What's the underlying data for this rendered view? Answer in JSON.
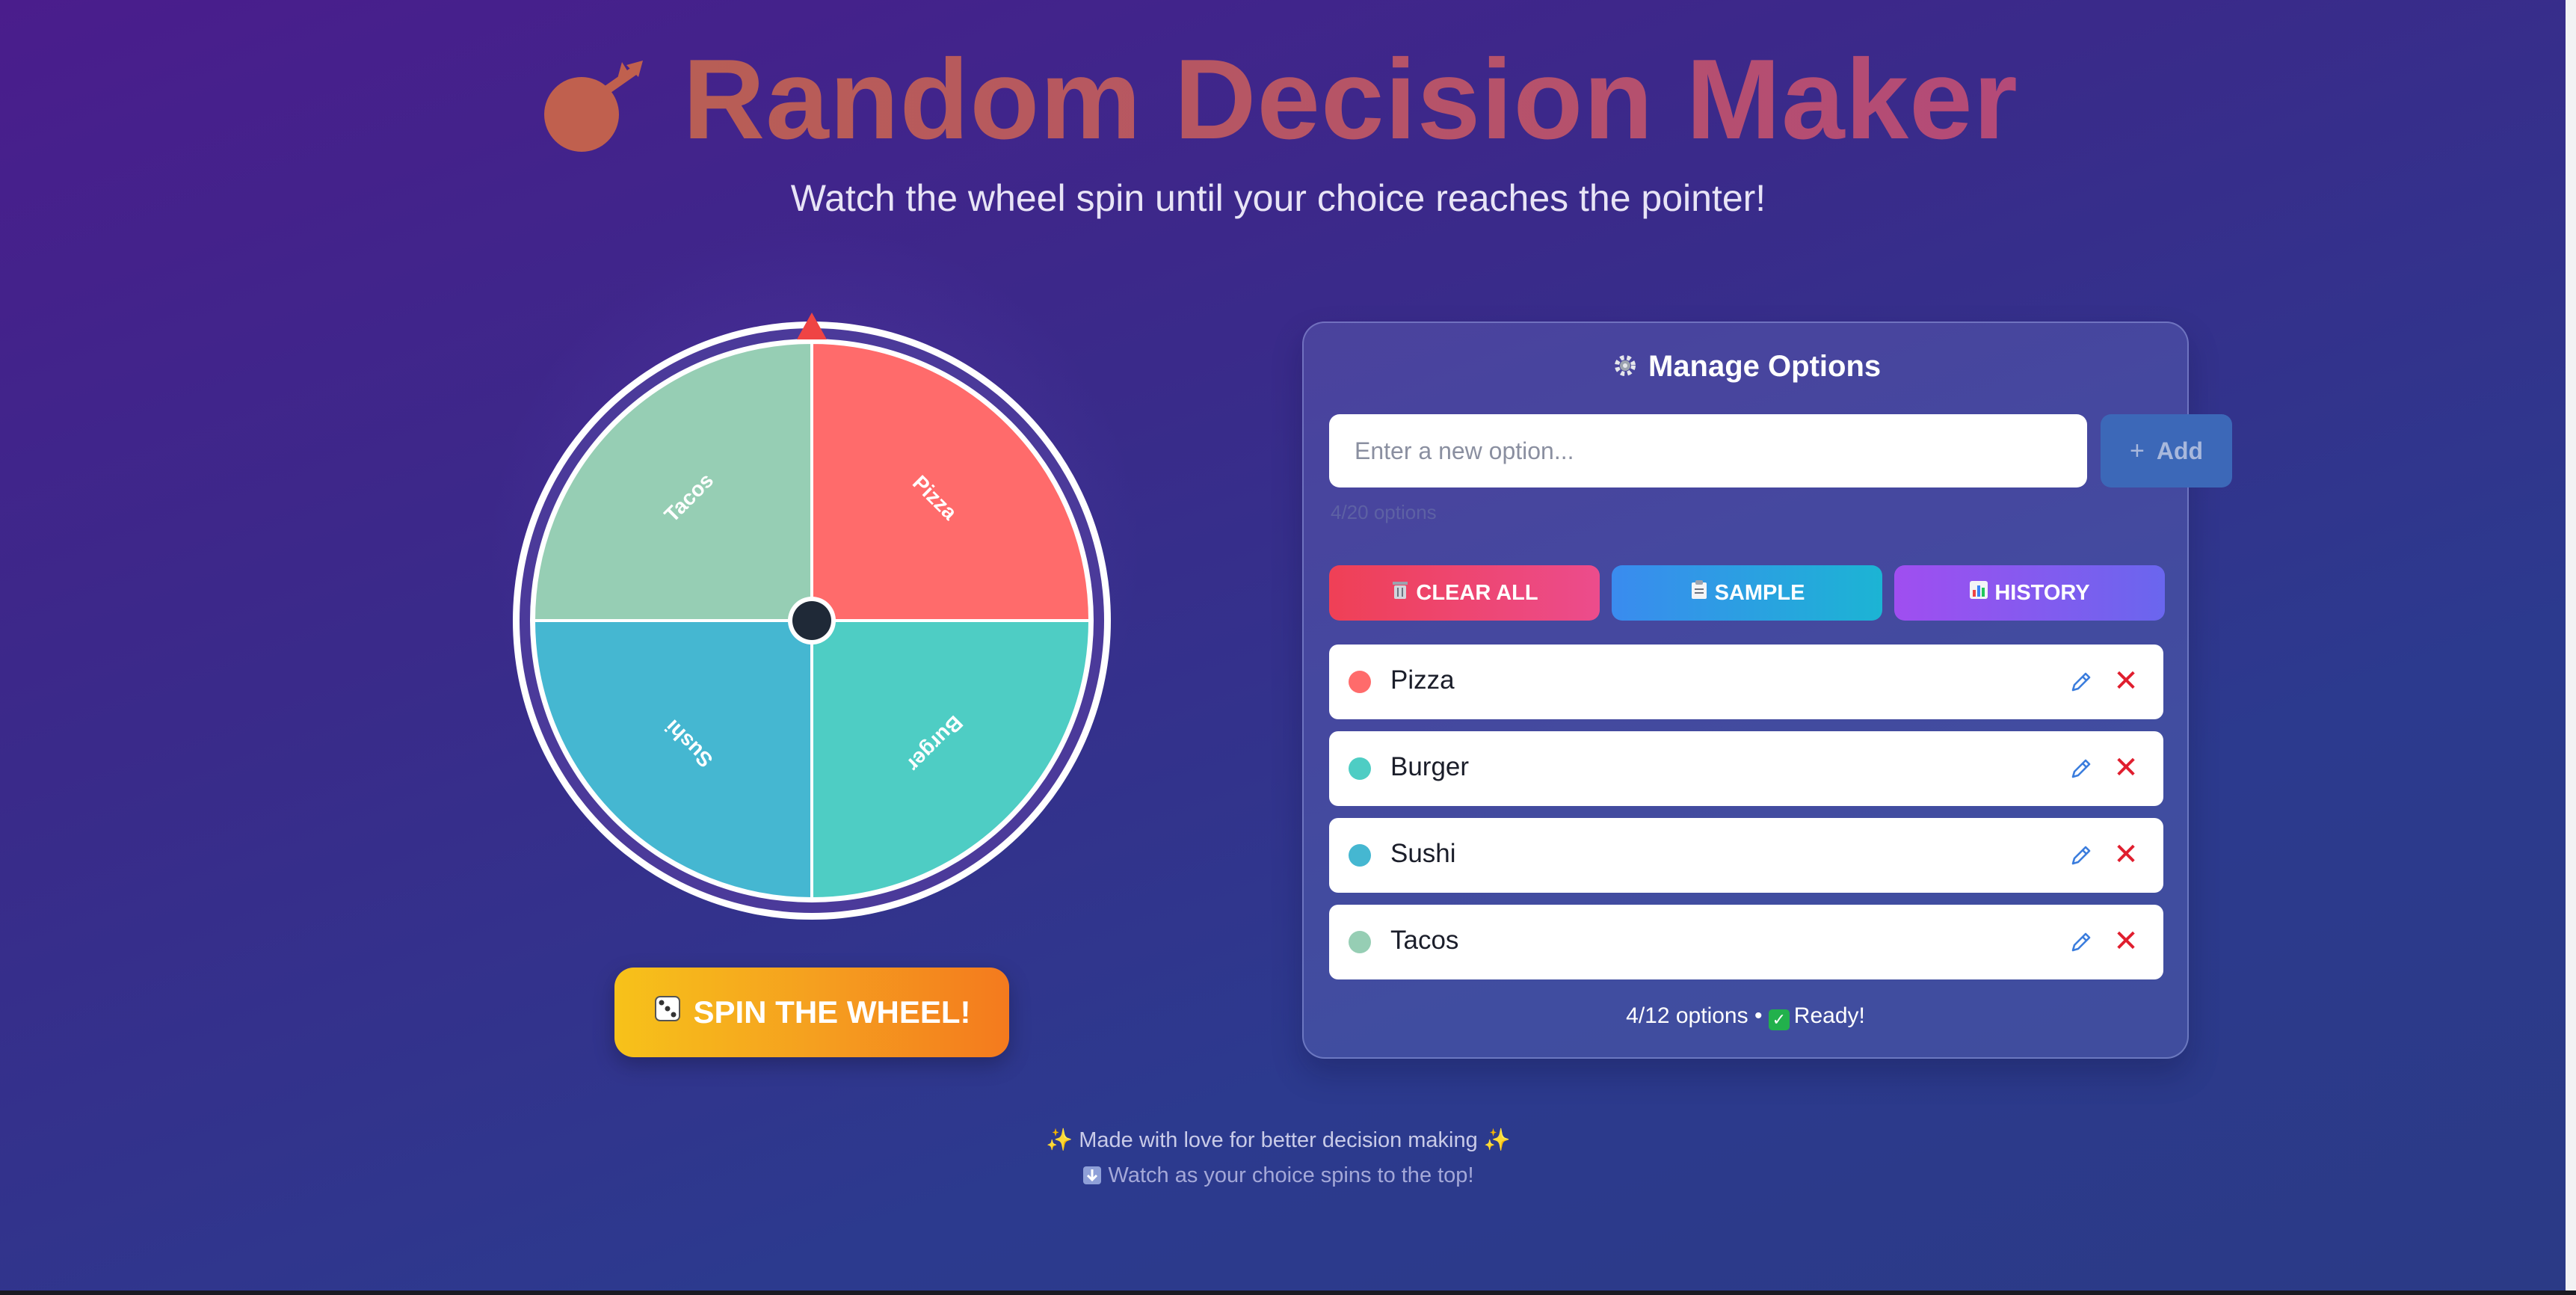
{
  "header": {
    "title_icon": "dart-icon",
    "title": "Random Decision Maker",
    "subtitle": "Watch the wheel spin until your choice reaches the pointer!"
  },
  "wheel": {
    "segments": [
      {
        "label": "Pizza",
        "color": "#ff6b6b"
      },
      {
        "label": "Burger",
        "color": "#4ecdc4"
      },
      {
        "label": "Sushi",
        "color": "#45b7d1"
      },
      {
        "label": "Tacos",
        "color": "#96ceb4"
      }
    ],
    "pointer_color": "#ef4444",
    "rim_color": "#4b3a9a",
    "hub_color": "#1f2937",
    "spin_icon": "dice-icon",
    "spin_label": "SPIN THE WHEEL!"
  },
  "panel": {
    "title_icon": "gear-icon",
    "title": "Manage Options",
    "input_placeholder": "Enter a new option...",
    "add_label": "Add",
    "faded_count": "4/20 options",
    "buttons": {
      "clear": {
        "icon": "trash-icon",
        "label": "CLEAR ALL"
      },
      "sample": {
        "icon": "clipboard-icon",
        "label": "SAMPLE"
      },
      "history": {
        "icon": "bar-chart-icon",
        "label": "HISTORY"
      }
    },
    "options": [
      {
        "label": "Pizza",
        "color": "#ff6b6b"
      },
      {
        "label": "Burger",
        "color": "#4ecdc4"
      },
      {
        "label": "Sushi",
        "color": "#45b7d1"
      },
      {
        "label": "Tacos",
        "color": "#96ceb4"
      }
    ],
    "status": "4/12 options • ✅ Ready!",
    "status_count": "4/12 options",
    "status_ready": "Ready!"
  },
  "footer": {
    "line1": "Made with love for better decision making",
    "line2": "Watch as your choice spins to the top!"
  }
}
